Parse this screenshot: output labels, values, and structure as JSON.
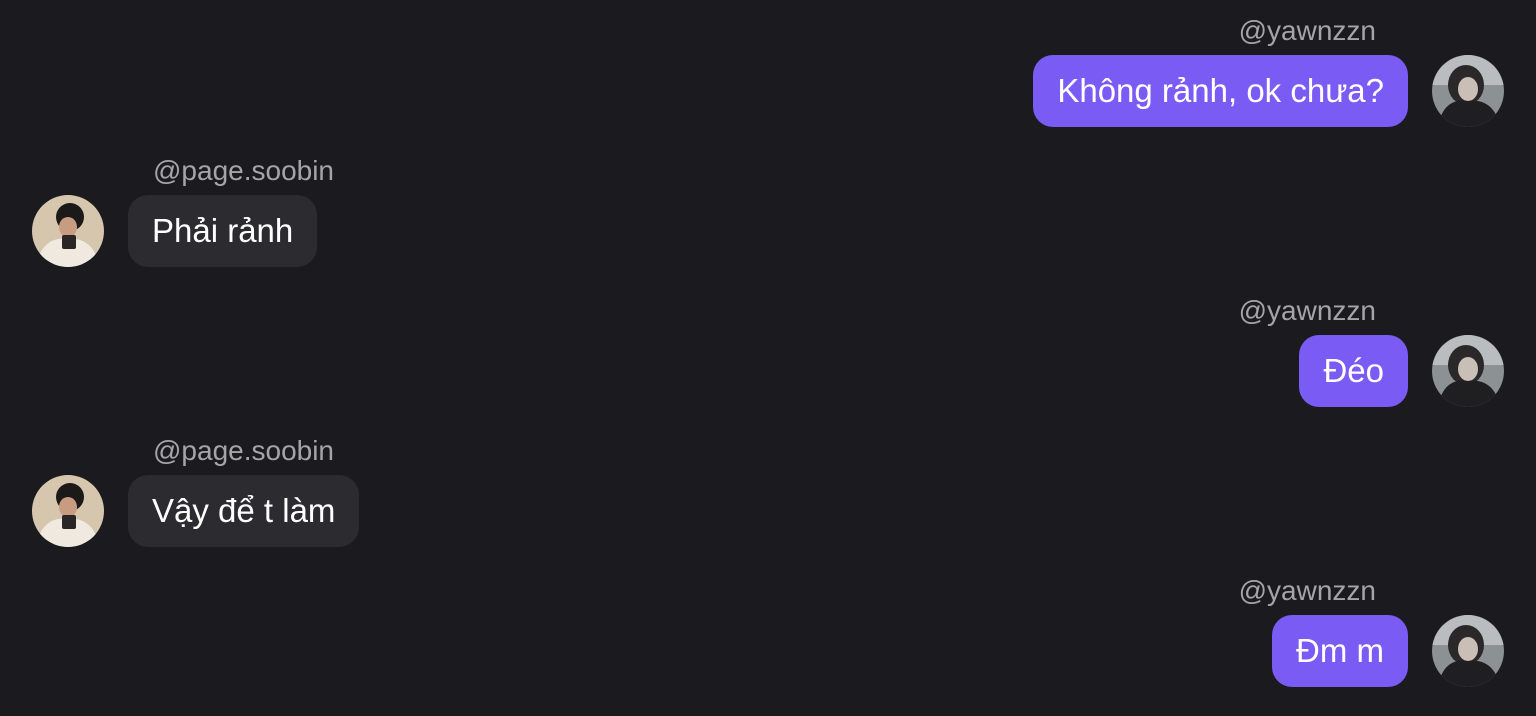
{
  "messages": [
    {
      "direction": "out",
      "username": "@yawnzzn",
      "text": "Không rảnh, ok chưa?",
      "avatar": "user-avatar-yawnzzn"
    },
    {
      "direction": "in",
      "username": "@page.soobin",
      "text": "Phải rảnh",
      "avatar": "user-avatar-page-soobin"
    },
    {
      "direction": "out",
      "username": "@yawnzzn",
      "text": "Đéo",
      "avatar": "user-avatar-yawnzzn"
    },
    {
      "direction": "in",
      "username": "@page.soobin",
      "text": "Vậy để t làm",
      "avatar": "user-avatar-page-soobin"
    },
    {
      "direction": "out",
      "username": "@yawnzzn",
      "text": "Đm m",
      "avatar": "user-avatar-yawnzzn"
    }
  ],
  "colors": {
    "background": "#1b1a1f",
    "outgoing_bubble": "#7a5cf5",
    "incoming_bubble": "#2c2b30",
    "username_text": "#a5a4aa",
    "message_text": "#ffffff"
  }
}
